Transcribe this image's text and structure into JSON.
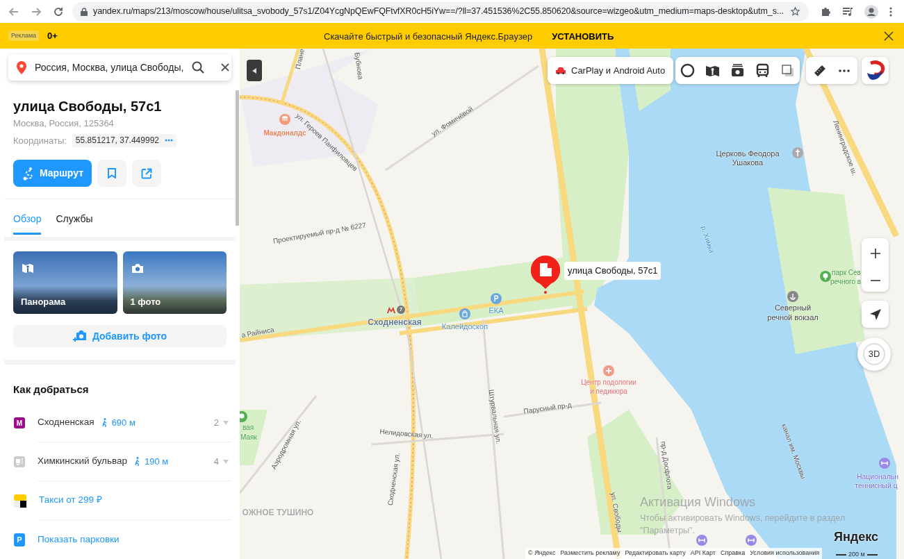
{
  "browser": {
    "url": "yandex.ru/maps/213/moscow/house/ulitsa_svobody_57s1/Z04YcgNpQEwFQFtvfXR0cH5iYw==/?ll=37.451536%2C55.850620&source=wizgeo&utm_medium=maps-desktop&utm_s..."
  },
  "ad_banner": {
    "badge": "Реклама",
    "age": "0+",
    "message": "Скачайте быстрый и безопасный Яндекс.Браузер",
    "action": "УСТАНОВИТЬ"
  },
  "search": {
    "value": "Россия, Москва, улица Свободы,"
  },
  "place": {
    "title": "улица Свободы, 57с1",
    "address": "Москва, Россия, 125364",
    "coords_label": "Координаты:",
    "coords": "55.851217, 37.449992"
  },
  "actions": [
    {
      "kind": "route",
      "label": "Маршрут"
    },
    {
      "kind": "bookmark"
    },
    {
      "kind": "share"
    }
  ],
  "tabs": [
    {
      "label": "Обзор",
      "selected": true
    },
    {
      "label": "Службы",
      "selected": false
    }
  ],
  "media": [
    {
      "kind": "panorama",
      "label": "Панорама"
    },
    {
      "kind": "photo",
      "label": "1 фото"
    }
  ],
  "add_photo": "Добавить фото",
  "directions": {
    "title": "Как добраться",
    "items": [
      {
        "kind": "metro",
        "badge": "М",
        "name": "Сходненская",
        "distance": "690 м",
        "count": "2"
      },
      {
        "kind": "bus",
        "name": "Химкинский бульвар",
        "distance": "190 м",
        "count": "4"
      },
      {
        "kind": "taxi",
        "name": "Такси от 299 ₽"
      },
      {
        "kind": "parking",
        "badge": "P",
        "name": "Показать парковки"
      }
    ]
  },
  "map": {
    "promo": "CarPlay и Android Auto",
    "pin_label": "улица Свободы, 57с1",
    "metro_line": "7",
    "compass": "3D",
    "labels": [
      {
        "text": "Плане",
        "kind": "street"
      },
      {
        "text": "Бубнова",
        "kind": "street"
      },
      {
        "text": "ул. Героев Панфиловцев",
        "kind": "street"
      },
      {
        "text": "Макдоналдс",
        "kind": "food"
      },
      {
        "text": "ул. Фомичёвой",
        "kind": "street"
      },
      {
        "text": "Проектируемый пр-д № 6227",
        "kind": "street"
      },
      {
        "text": "Сходненская",
        "kind": "metro"
      },
      {
        "text": "Калейдоскоп",
        "kind": "shop"
      },
      {
        "text": "ЕКА",
        "kind": "shop"
      },
      {
        "text": "а Райниса",
        "kind": "street"
      },
      {
        "text": "Центр подологии",
        "kind": "medical"
      },
      {
        "text": "и педикюра",
        "kind": "medical"
      },
      {
        "text": "Парусный пр-д",
        "kind": "street"
      },
      {
        "text": "Штурвальная ул.",
        "kind": "street"
      },
      {
        "text": "Нелидовская ул.",
        "kind": "street"
      },
      {
        "text": "Аэродромная ул.",
        "kind": "street"
      },
      {
        "text": "вая",
        "kind": "park"
      },
      {
        "text": "Маяк",
        "kind": "park"
      },
      {
        "text": "Сходненская ул.",
        "kind": "street"
      },
      {
        "text": "ОЖНОЕ ТУШИНО",
        "kind": "district"
      },
      {
        "text": "ул. Свободы",
        "kind": "street"
      },
      {
        "text": "пр-д Досфлота",
        "kind": "street"
      },
      {
        "text": "канал им. Москвы",
        "kind": "street"
      },
      {
        "text": "р. Химка",
        "kind": "water"
      },
      {
        "text": "Церковь Феодора",
        "kind": "place"
      },
      {
        "text": "Ушакова",
        "kind": "place"
      },
      {
        "text": "Ленинградское ш.",
        "kind": "street"
      },
      {
        "text": "Северный",
        "kind": "place"
      },
      {
        "text": "речной вокзал",
        "kind": "place"
      },
      {
        "text": "парк Сев",
        "kind": "park"
      },
      {
        "text": "речного в",
        "kind": "park"
      },
      {
        "text": "Национальн",
        "kind": "sport"
      },
      {
        "text": "теннисный ц",
        "kind": "sport"
      }
    ],
    "attribution": [
      "© Яндекс",
      "Разместить рекламу",
      "Редактировать карту",
      "API Карт",
      "Справка",
      "Условия использования"
    ],
    "scale": "200 м",
    "logo": "Яндекс"
  },
  "windows_activation": {
    "title": "Активация Windows",
    "lines": [
      "Чтобы активировать Windows, перейдите в раздел",
      "\"Параметры\"."
    ]
  }
}
